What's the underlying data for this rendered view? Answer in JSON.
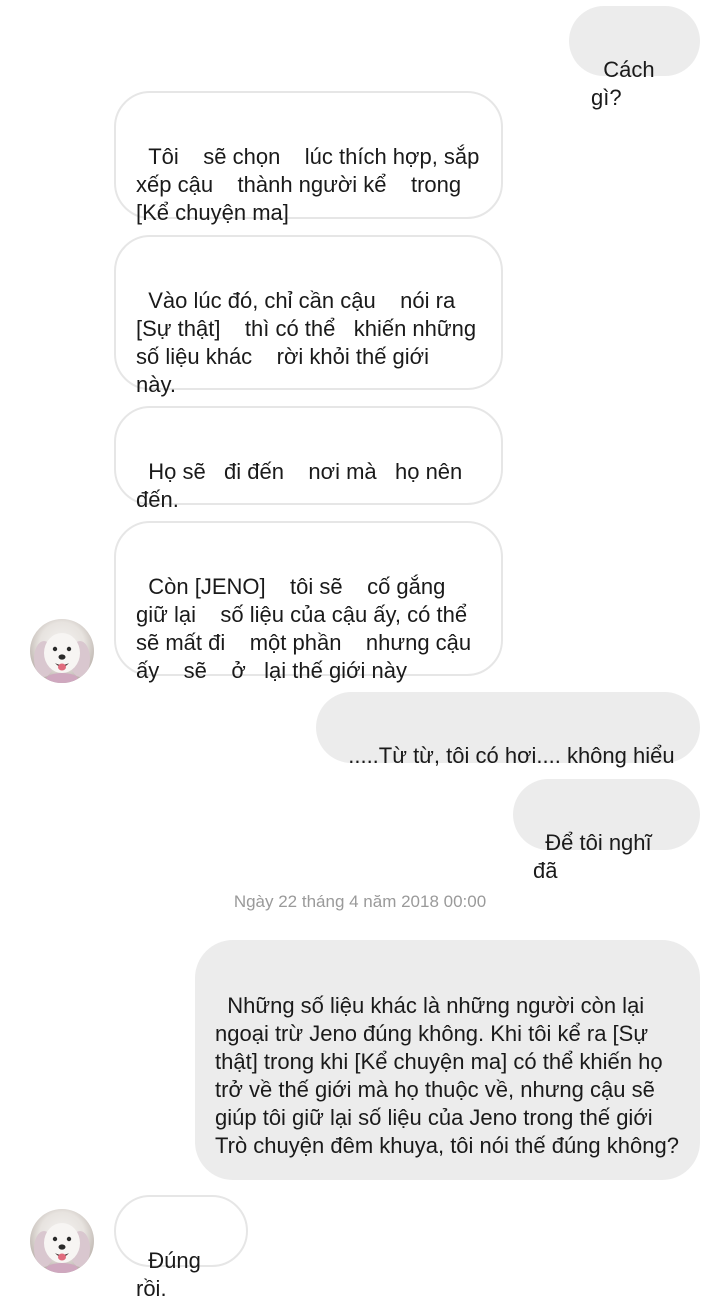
{
  "messages": [
    {
      "text": "Cách gì?"
    },
    {
      "text": "Tôi    sẽ chọn    lúc thích hợp, sắp xếp cậu    thành người kể    trong [Kể chuyện ma]"
    },
    {
      "text": "Vào lúc đó, chỉ cần cậu    nói ra [Sự thật]    thì có thể   khiến những số liệu khác    rời khỏi thế giới   này."
    },
    {
      "text": "Họ sẽ   đi đến    nơi mà   họ nên đến."
    },
    {
      "text": "Còn [JENO]    tôi sẽ    cố gắng giữ lại    số liệu của cậu ấy, có thể sẽ mất đi    một phần    nhưng cậu ấy    sẽ    ở   lại thế giới này"
    },
    {
      "text": ".....Từ từ, tôi có hơi.... không hiểu"
    },
    {
      "text": "Để tôi nghĩ đã"
    },
    {
      "text": "Những số liệu khác là những người còn lại ngoại trừ Jeno đúng không. Khi tôi kể ra [Sự thật] trong khi [Kể chuyện ma] có thể khiến họ trở về thế giới mà họ thuộc về, nhưng cậu sẽ giúp tôi giữ lại số liệu của Jeno trong thế giới Trò chuyện đêm khuya, tôi nói thế đúng không?"
    },
    {
      "text": "Đúng rồi."
    }
  ],
  "timestamp": "Ngày 22 tháng 4 năm 2018 00:00",
  "avatar_icon": "samoyed-dog-avatar-icon",
  "colors": {
    "outgoing_bubble": "#ececec",
    "incoming_border": "#e6e6e6",
    "timestamp_text": "#9a9a9a"
  }
}
